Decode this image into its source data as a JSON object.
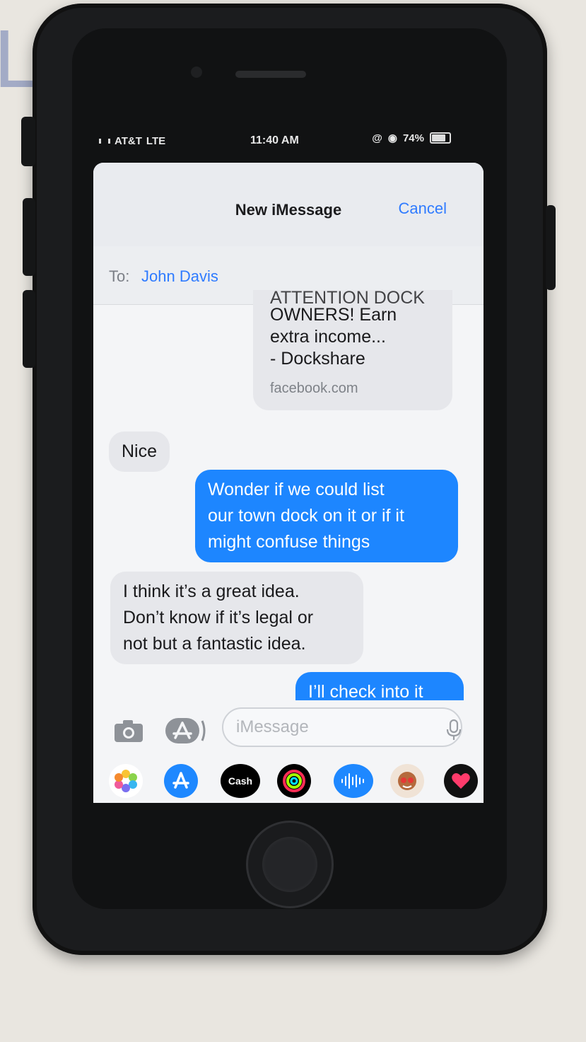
{
  "status_bar": {
    "carrier": "AT&T",
    "network": "LTE",
    "time": "11:40 AM",
    "battery": "74%",
    "battery_level": 0.74
  },
  "sheet": {
    "title": "New iMessage",
    "cancel_label": "Cancel",
    "to_label": "To:",
    "recipient": "John Davis"
  },
  "messages": [
    {
      "from": "them",
      "type": "link",
      "title_lines": [
        "ATTENTION DOCK",
        "OWNERS! Earn",
        "extra income...",
        "- Dockshare"
      ],
      "domain": "facebook.com"
    },
    {
      "from": "them",
      "type": "text",
      "text": "Nice"
    },
    {
      "from": "me",
      "type": "text",
      "lines": [
        "Wonder if we could list",
        "our town dock on it or if it",
        "might confuse things"
      ]
    },
    {
      "from": "them",
      "type": "text",
      "lines": [
        "I think it’s a great idea.",
        "Don’t know if it’s legal or",
        "not but a fantastic idea."
      ]
    },
    {
      "from": "me",
      "type": "text",
      "text": "I’ll check into it"
    }
  ],
  "composer": {
    "placeholder": "iMessage"
  },
  "app_drawer": {
    "apps": [
      {
        "name": "photos",
        "color": "#ffffff"
      },
      {
        "name": "app-store",
        "color": "#1e88ff"
      },
      {
        "name": "apple-cash",
        "label": "Cash",
        "color": "#000000"
      },
      {
        "name": "activity",
        "color": "#000000"
      },
      {
        "name": "audio-message",
        "color": "#1e88ff"
      },
      {
        "name": "memoji",
        "color": "#f0e3d6"
      },
      {
        "name": "digital-touch",
        "color": "#111111"
      }
    ]
  },
  "colors": {
    "accent_blue": "#2f7bff",
    "outgoing_bubble": "#1d86ff",
    "incoming_bubble": "#e6e7eb"
  }
}
